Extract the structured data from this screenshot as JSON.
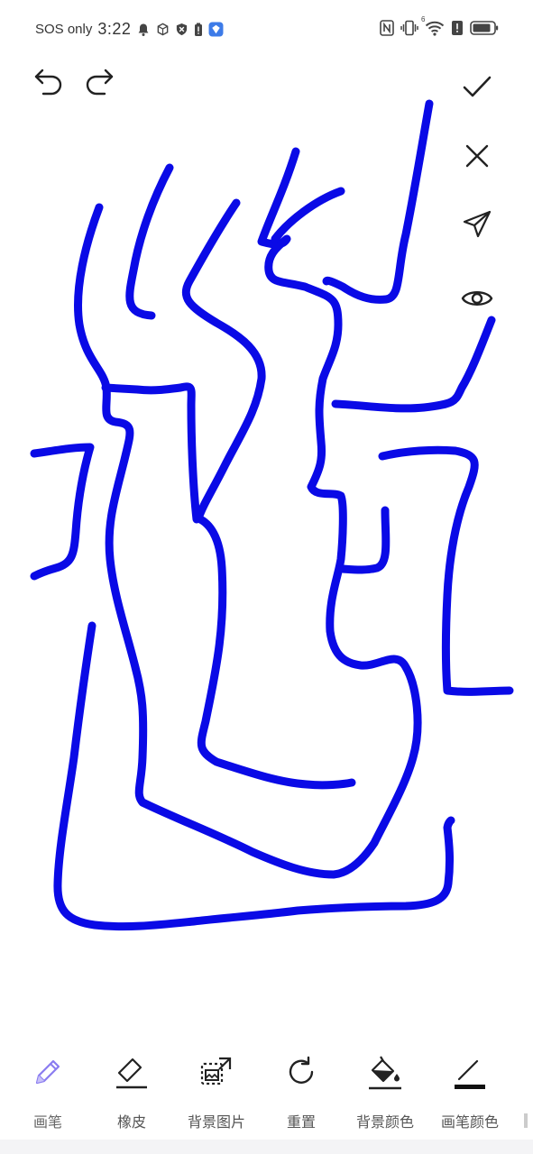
{
  "status_bar": {
    "carrier": "SOS only",
    "time": "3:22",
    "signal_label": "6"
  },
  "top_toolbar": {
    "undo_icon": "undo-icon",
    "redo_icon": "redo-icon",
    "confirm_icon": "checkmark-icon",
    "close_icon": "close-icon",
    "send_icon": "send-icon",
    "preview_icon": "eye-icon"
  },
  "canvas": {
    "stroke_color": "#0a0ae6",
    "background": "#ffffff"
  },
  "bottom_tools": [
    {
      "label": "画笔",
      "icon": "pencil-icon",
      "active": true
    },
    {
      "label": "橡皮",
      "icon": "eraser-icon",
      "active": false
    },
    {
      "label": "背景图片",
      "icon": "background-image-icon",
      "active": false
    },
    {
      "label": "重置",
      "icon": "reset-icon",
      "active": false
    },
    {
      "label": "背景颜色",
      "icon": "paint-bucket-icon",
      "active": false
    },
    {
      "label": "画笔颜色",
      "icon": "pen-color-icon",
      "active": false
    }
  ],
  "colors": {
    "active_tool": "#8a7cf0",
    "icon": "#222222",
    "stroke": "#0a0ae6"
  }
}
